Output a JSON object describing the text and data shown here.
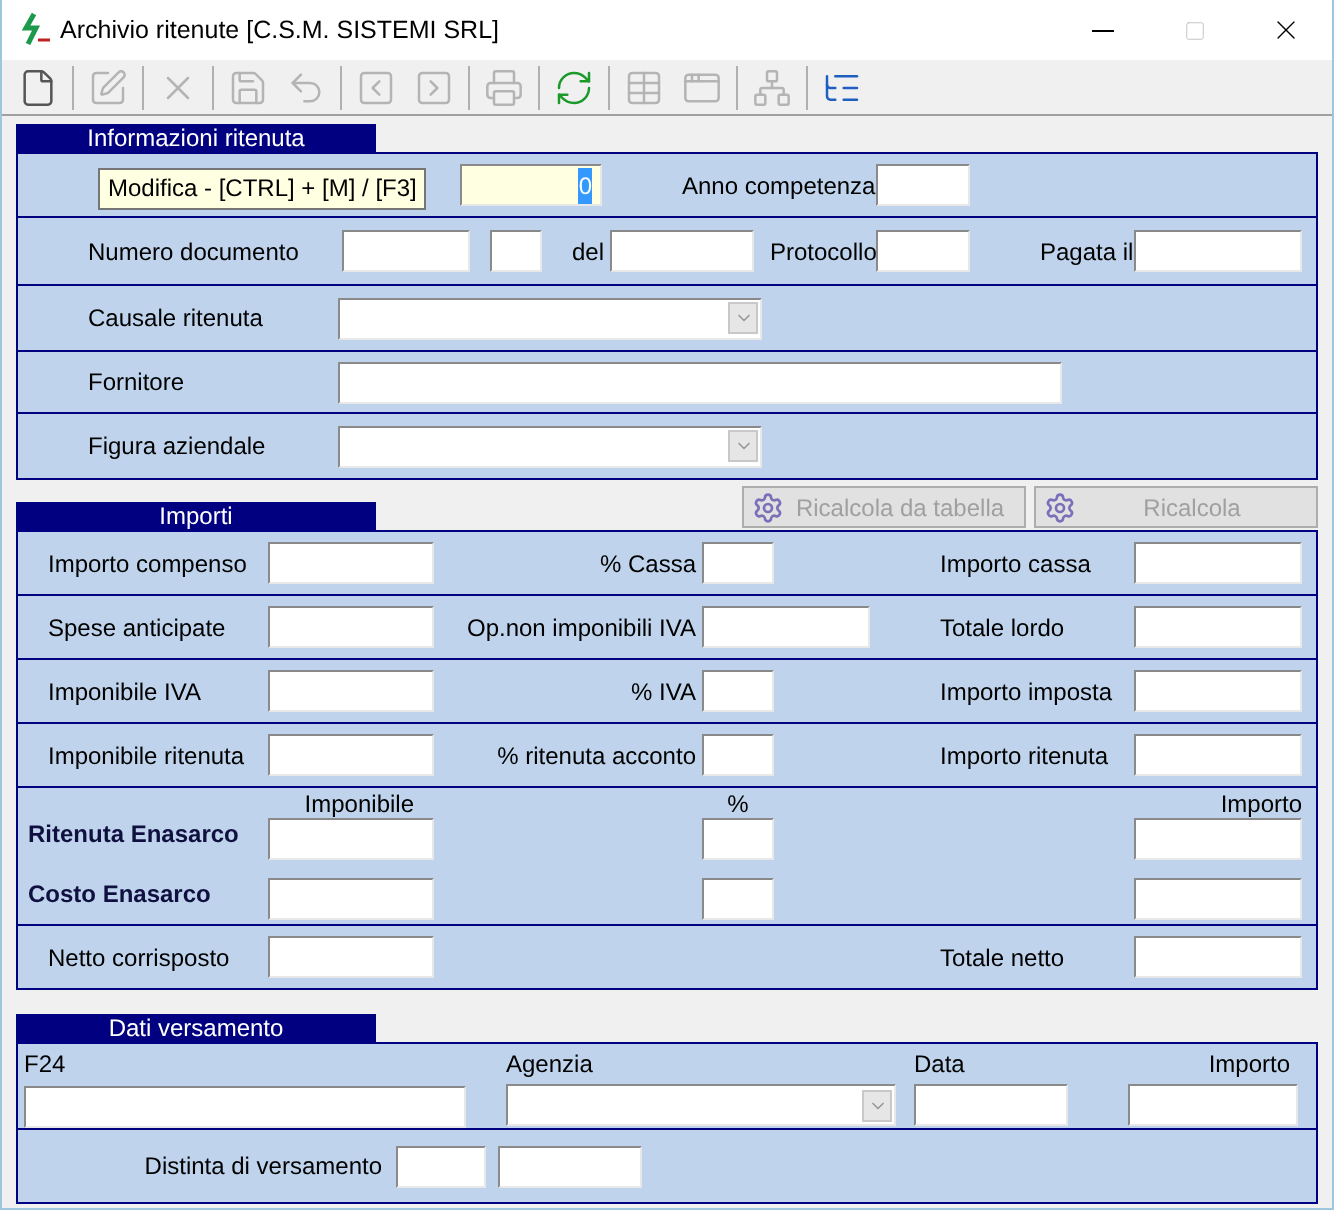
{
  "window": {
    "title": "Archivio ritenute [C.S.M. SISTEMI SRL]"
  },
  "toolbar": [
    {
      "kind": "new",
      "disabled": false
    },
    {
      "kind": "separator"
    },
    {
      "kind": "edit",
      "disabled": true
    },
    {
      "kind": "separator"
    },
    {
      "kind": "delete",
      "disabled": true
    },
    {
      "kind": "separator"
    },
    {
      "kind": "save",
      "disabled": true
    },
    {
      "kind": "undo",
      "disabled": true
    },
    {
      "kind": "separator"
    },
    {
      "kind": "prev",
      "disabled": true
    },
    {
      "kind": "next",
      "disabled": true
    },
    {
      "kind": "separator"
    },
    {
      "kind": "print",
      "disabled": true
    },
    {
      "kind": "separator"
    },
    {
      "kind": "refresh",
      "disabled": false
    },
    {
      "kind": "separator"
    },
    {
      "kind": "table",
      "disabled": true
    },
    {
      "kind": "form",
      "disabled": true
    },
    {
      "kind": "separator"
    },
    {
      "kind": "diagram",
      "disabled": true
    },
    {
      "kind": "separator"
    },
    {
      "kind": "tree",
      "disabled": false
    }
  ],
  "info": {
    "title": "Informazioni ritenuta",
    "tooltip": "Modifica - [CTRL] + [M]  / [F3]",
    "number": {
      "value": "0",
      "selected": true
    },
    "anno_label": "Anno competenza",
    "numero_label": "Numero documento",
    "del_label": "del",
    "protocollo_label": "Protocollo",
    "pagata_label": "Pagata il",
    "causale_label": "Causale ritenuta",
    "fornitore_label": "Fornitore",
    "figura_label": "Figura aziendale"
  },
  "importi": {
    "title": "Importi",
    "buttons": [
      {
        "label": "Ricalcola da tabella",
        "disabled": true
      },
      {
        "label": "Ricalcola",
        "disabled": true
      }
    ],
    "rows": [
      {
        "left": "Importo compenso",
        "middle": "% Cassa",
        "right": "Importo cassa",
        "kind": "short"
      },
      {
        "left": "Spese anticipate",
        "middle": "Op.non imponibili IVA",
        "right": "Totale lordo",
        "kind": "wide"
      },
      {
        "left": "Imponibile IVA",
        "middle": "% IVA",
        "right": "Importo imposta",
        "kind": "short"
      },
      {
        "left": "Imponibile ritenuta",
        "middle": "% ritenuta acconto",
        "right": "Importo ritenuta",
        "kind": "short"
      }
    ],
    "enasarco": {
      "headers": [
        "Imponibile",
        "%",
        "Importo"
      ],
      "rows": [
        "Ritenuta Enasarco",
        "Costo Enasarco"
      ]
    },
    "netto_label": "Netto corrisposto",
    "totale_netto_label": "Totale netto"
  },
  "versamento": {
    "title": "Dati versamento",
    "labels": [
      "F24",
      "Agenzia",
      "Data",
      "Importo"
    ],
    "distinta_label": "Distinta di versamento"
  }
}
